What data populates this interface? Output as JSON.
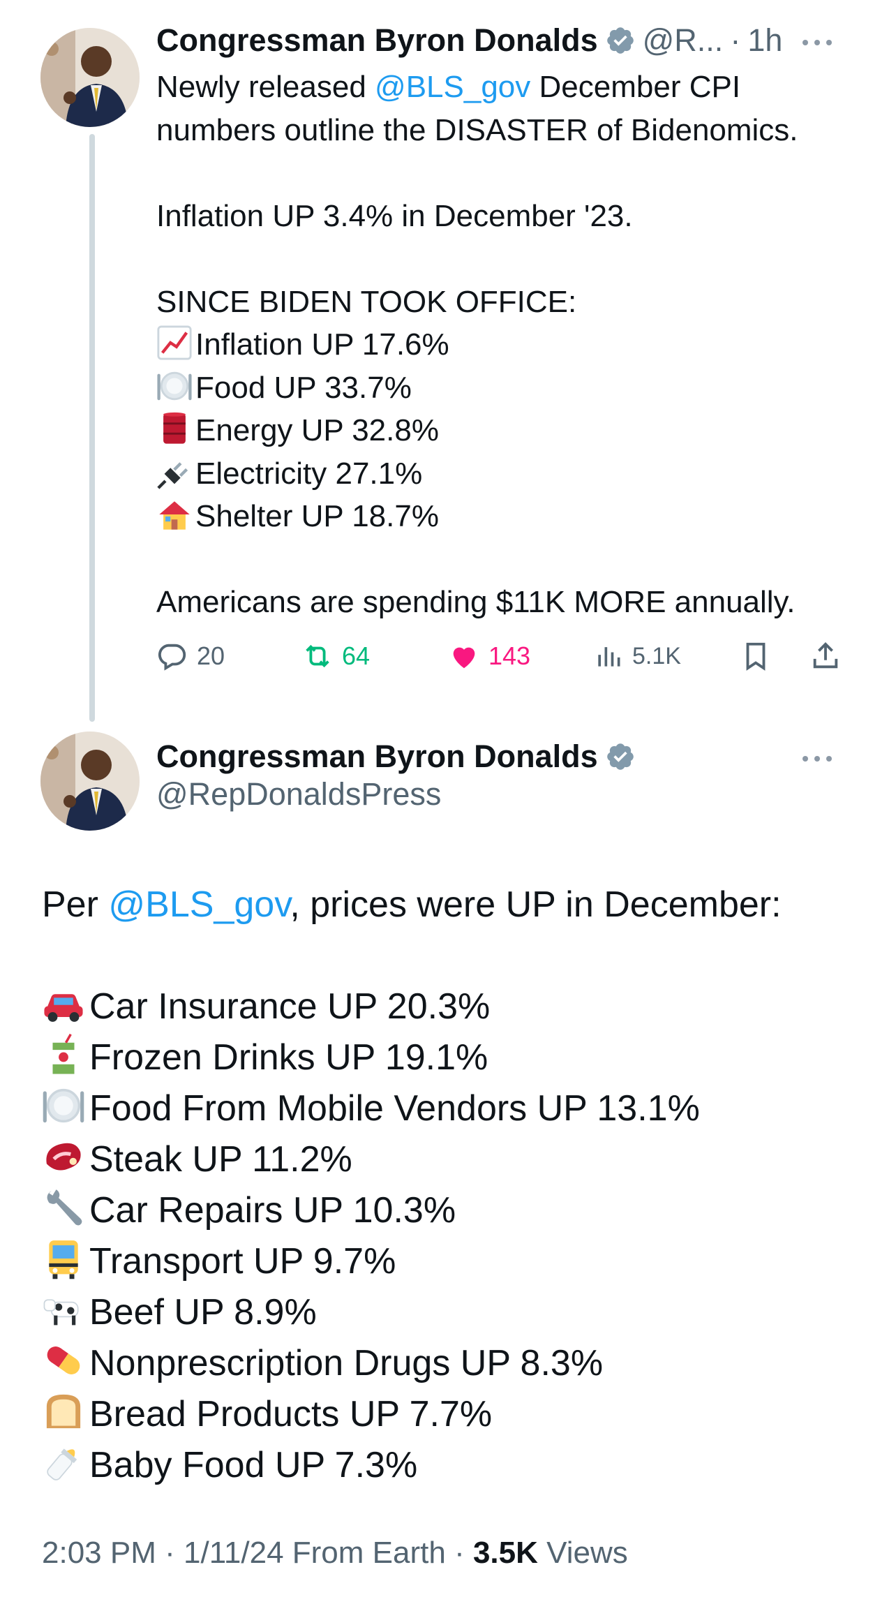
{
  "tweet1": {
    "display_name": "Congressman Byron Donalds",
    "handle_short": "@R...",
    "time_sep": "·",
    "time": "1h",
    "text": {
      "intro_pre": "Newly released ",
      "mention": "@BLS_gov",
      "intro_post": " December CPI",
      "intro_line2": "numbers outline the DISASTER of Bidenomics.",
      "inflation_line": "Inflation UP 3.4% in December '23.",
      "since_header": "SINCE BIDEN TOOK OFFICE:",
      "items": [
        {
          "icon": "chart-increasing-icon",
          "label": "Inflation UP 17.6%"
        },
        {
          "icon": "plate-cutlery-icon",
          "label": "Food UP 33.7%"
        },
        {
          "icon": "oil-drum-icon",
          "label": "Energy UP 32.8%"
        },
        {
          "icon": "electric-plug-icon",
          "label": "Electricity 27.1%"
        },
        {
          "icon": "house-icon",
          "label": "Shelter UP 18.7%"
        }
      ],
      "closing": "Americans are spending $11K MORE annually."
    },
    "actions": {
      "replies": "20",
      "retweets": "64",
      "likes": "143",
      "views": "5.1K"
    },
    "colors": {
      "retweet": "#00ba7c",
      "like": "#f91880",
      "icon": "#536471",
      "mention": "#1d9bf0"
    }
  },
  "tweet2": {
    "display_name": "Congressman Byron Donalds",
    "handle": "@RepDonaldsPress",
    "intro_pre": "Per ",
    "mention": "@BLS_gov",
    "intro_post": ", prices were UP in December:",
    "items": [
      {
        "icon": "car-icon",
        "label": "Car Insurance UP 20.3%"
      },
      {
        "icon": "juice-box-icon",
        "label": "Frozen Drinks UP 19.1%"
      },
      {
        "icon": "plate-cutlery-icon",
        "label": "Food From Mobile Vendors UP 13.1%"
      },
      {
        "icon": "steak-icon",
        "label": "Steak UP 11.2%"
      },
      {
        "icon": "wrench-icon",
        "label": "Car Repairs UP 10.3%"
      },
      {
        "icon": "bus-icon",
        "label": "Transport UP 9.7%"
      },
      {
        "icon": "cow-icon",
        "label": "Beef UP 8.9%"
      },
      {
        "icon": "pill-icon",
        "label": "Nonprescription Drugs UP 8.3%"
      },
      {
        "icon": "bread-icon",
        "label": "Bread Products UP 7.7%"
      },
      {
        "icon": "baby-bottle-icon",
        "label": "Baby Food UP 7.3%"
      }
    ],
    "footer": {
      "time": "2:03 PM",
      "sep1": "·",
      "date": "1/11/24",
      "source": "From Earth",
      "sep2": "·",
      "views_count": "3.5K",
      "views_label": "Views"
    }
  }
}
